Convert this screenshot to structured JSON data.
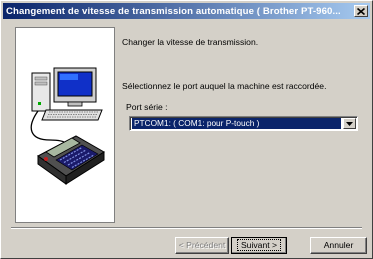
{
  "window": {
    "title": "Changement de vitesse de transmission automatique  ( Brother PT-960..."
  },
  "content": {
    "intro": "Changer la vitesse de transmission.",
    "port_prompt": "Sélectionnez le port auquel la machine est raccordée.",
    "serial_label": "Port série :",
    "port_selected": "PTCOM1: ( COM1: pour P-touch )"
  },
  "buttons": {
    "prev_label": "< Précédent",
    "next_label": "Suivant >",
    "cancel_label": "Annuler"
  },
  "icons": {
    "close": "close-icon",
    "dropdown": "chevron-down-icon",
    "computer": "computer-icon",
    "printer": "label-printer-icon"
  },
  "colors": {
    "titlebar_start": "#0a246a",
    "titlebar_end": "#a6caf0",
    "selection": "#0a246a",
    "face": "#d4d0c8"
  }
}
